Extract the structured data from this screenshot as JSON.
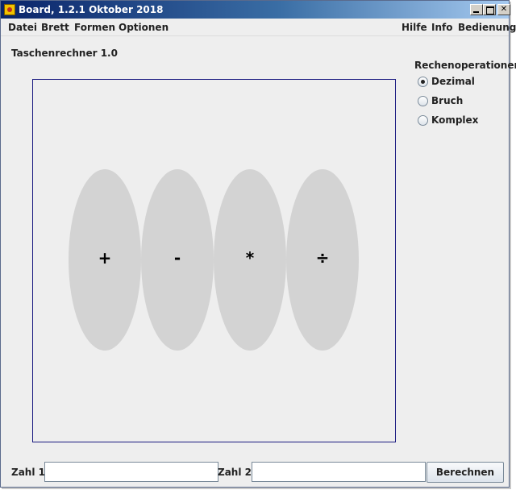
{
  "window": {
    "title": "Board, 1.2.1 Oktober 2018"
  },
  "menu": {
    "left": [
      "Datei",
      "Brett",
      "Formen",
      "Optionen"
    ],
    "right": [
      "Hilfe",
      "Info",
      "Bedienung"
    ]
  },
  "app": {
    "heading": "Taschenrechner 1.0"
  },
  "operations": {
    "symbols": [
      "+",
      "-",
      "*",
      "÷"
    ],
    "fill_color": "#d3d3d3"
  },
  "mode": {
    "group_label": "Rechenoperationen",
    "options": [
      "Dezimal",
      "Bruch",
      "Komplex"
    ],
    "selected": "Dezimal"
  },
  "inputs": {
    "zahl1_label": "Zahl 1:",
    "zahl1_value": "",
    "zahl2_label": "Zahl 2:",
    "zahl2_value": ""
  },
  "actions": {
    "compute_label": "Berechnen"
  },
  "colors": {
    "canvas_border": "#1a1a80",
    "background": "#eeeeee"
  }
}
